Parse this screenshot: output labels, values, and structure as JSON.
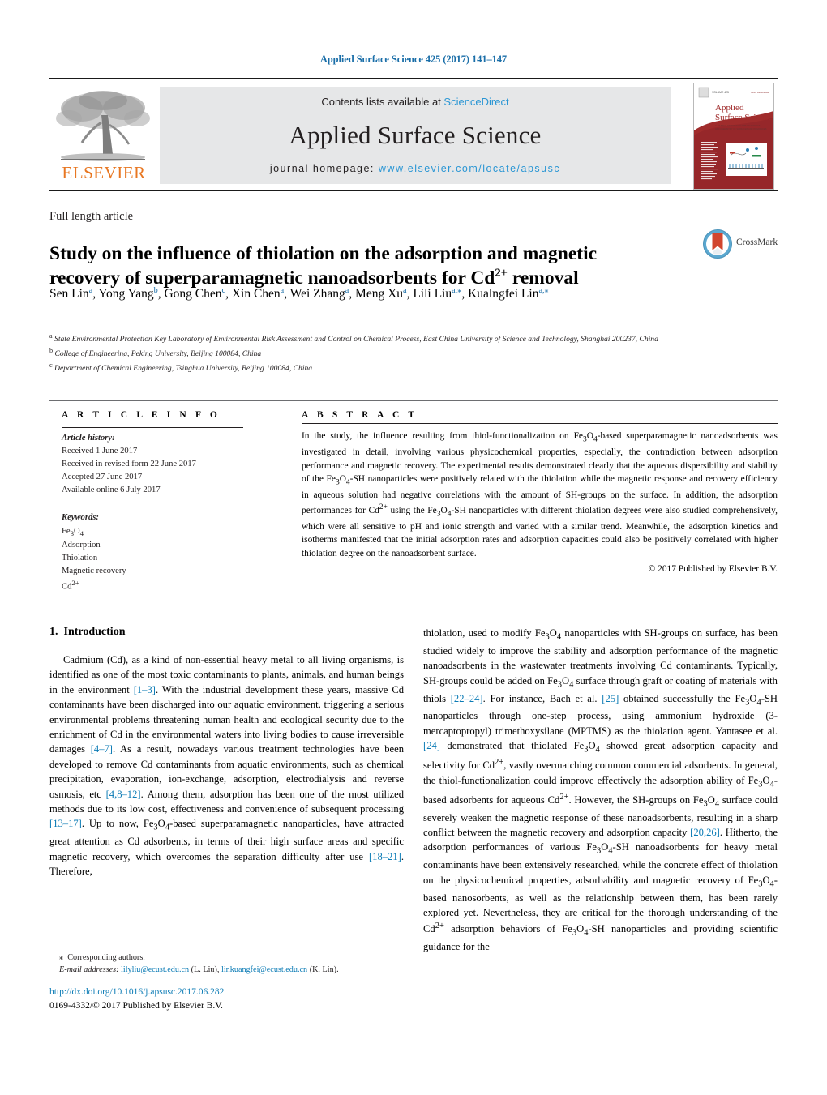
{
  "running_head": "Applied Surface Science 425 (2017) 141–147",
  "masthead": {
    "elsevier_wordmark": "ELSEVIER",
    "contents_prefix": "Contents lists available at ",
    "contents_link": "ScienceDirect",
    "journal_title": "Applied Surface Science",
    "homepage_prefix": "journal homepage: ",
    "homepage_url": "www.elsevier.com/locate/apsusc",
    "cover": {
      "publisher_line": "ELSEVIER",
      "issue_line": "VOLUME 425",
      "title_line1": "Applied",
      "title_line2": "Surface Science",
      "subtitle": "A JOURNAL DEVOTED TO APPLIED PHYSICS AND CHEMISTRY OF SURFACES AND INTERFACES"
    }
  },
  "article_type": "Full length article",
  "title_line1": "Study on the influence of thiolation on the adsorption and magnetic",
  "title_line2_a": "recovery of superparamagnetic nanoadsorbents for Cd",
  "title_line2_sup": "2+",
  "title_line2_b": " removal",
  "crossmark_label": "CrossMark",
  "authors": [
    {
      "name": "Sen Lin",
      "sup": "a",
      "sep": ", "
    },
    {
      "name": "Yong Yang",
      "sup": "b",
      "sep": ", "
    },
    {
      "name": "Gong Chen",
      "sup": "c",
      "sep": ", "
    },
    {
      "name": "Xin Chen",
      "sup": "a",
      "sep": ", "
    },
    {
      "name": "Wei Zhang",
      "sup": "a",
      "sep": ", "
    },
    {
      "name": "Meng Xu",
      "sup": "a",
      "sep": ", "
    },
    {
      "name": "Lili Liu",
      "sup": "a,⁎",
      "sep": ", "
    },
    {
      "name": "Kualngfei Lin",
      "sup": "a,⁎",
      "sep": ""
    }
  ],
  "affiliations": [
    {
      "sup": "a",
      "text": "State Environmental Protection Key Laboratory of Environmental Risk Assessment and Control on Chemical Process, East China University of Science and Technology,  Shanghai 200237, China"
    },
    {
      "sup": "b",
      "text": "College of Engineering, Peking University, Beijing 100084, China"
    },
    {
      "sup": "c",
      "text": "Department of Chemical Engineering, Tsinghua University, Beijing 100084, China"
    }
  ],
  "article_info": {
    "heading": "A R T I C L E    I N F O",
    "history_label": "Article history:",
    "history": [
      "Received 1 June 2017",
      "Received in revised form 22 June 2017",
      "Accepted 27 June 2017",
      "Available online 6 July 2017"
    ],
    "keywords_label": "Keywords:",
    "keywords": [
      "Fe3O4",
      "Adsorption",
      "Thiolation",
      "Magnetic recovery",
      "Cd2+"
    ]
  },
  "abstract": {
    "heading": "A B S T R A C T",
    "text": "In the study, the influence resulting from thiol-functionalization on Fe₃O₄-based superparamagnetic nanoadsorbents was investigated in detail, involving various physicochemical properties, especially, the contradiction between adsorption performance and magnetic recovery. The experimental results demonstrated clearly that the aqueous dispersibility and stability of the Fe₃O₄-SH nanoparticles were positively related with the thiolation while the magnetic response and recovery efficiency in aqueous solution had negative correlations with the amount of SH-groups on the surface. In addition, the adsorption performances for Cd²⁺ using the Fe₃O₄-SH nanoparticles with different thiolation degrees were also studied comprehensively, which were all sensitive to pH and ionic strength and varied with a similar trend. Meanwhile, the adsorption kinetics and isotherms manifested that the initial adsorption rates and adsorption capacities could also be positively correlated with higher thiolation degree on the nanoadsorbent surface.",
    "copyright": "© 2017 Published by Elsevier B.V."
  },
  "body": {
    "section_number": "1.",
    "section_title": "Introduction",
    "left_paragraph": "Cadmium (Cd), as a kind of non-essential heavy metal to all living organisms, is identified as one of the most toxic contaminants to plants, animals, and human beings in the environment [1–3]. With the industrial development these years, massive Cd contaminants have been discharged into our aquatic environment, triggering a serious environmental problems threatening human health and ecological security due to the enrichment of Cd in the environmental waters into living bodies to cause irreversible damages [4–7]. As a result, nowadays various treatment technologies have been developed to remove Cd contaminants from aquatic environments, such as chemical precipitation, evaporation, ion-exchange, adsorption, electrodialysis and reverse osmosis, etc [4,8–12]. Among them, adsorption has been one of the most utilized methods due to its low cost, effectiveness and convenience of subsequent processing [13–17]. Up to now, Fe₃O₄-based superparamagnetic nanoparticles, have attracted great attention as Cd adsorbents, in terms of their high surface areas and specific magnetic recovery, which overcomes the separation difficulty after use [18–21]. Therefore,",
    "right_paragraph": "thiolation, used to modify Fe₃O₄ nanoparticles with SH-groups on surface, has been studied widely to improve the stability and adsorption performance of the magnetic nanoadsorbents in the wastewater treatments involving Cd contaminants. Typically, SH-groups could be added on Fe₃O₄ surface through graft or coating of materials with thiols [22–24]. For instance, Bach et al. [25] obtained successfully the Fe₃O₄-SH nanoparticles through one-step process, using ammonium hydroxide (3-mercaptopropyl) trimethoxysilane (MPTMS) as the thiolation agent. Yantasee et al. [24] demonstrated that thiolated Fe₃O₄ showed great adsorption capacity and selectivity for Cd²⁺, vastly overmatching common commercial adsorbents. In general, the thiol-functionalization could improve effectively the adsorption ability of Fe₃O₄-based adsorbents for aqueous Cd²⁺. However, the SH-groups on Fe₃O₄ surface could severely weaken the magnetic response of these nanoadsorbents, resulting in a sharp conflict between the magnetic recovery and adsorption capacity [20,26]. Hitherto, the adsorption performances of various Fe₃O₄-SH nanoadsorbents for heavy metal contaminants have been extensively researched, while the concrete effect of thiolation on the physicochemical properties, adsorbability and magnetic recovery of Fe₃O₄-based nanosorbents, as well as the relationship between them, has been rarely explored yet. Nevertheless, they are critical for the thorough understanding of the Cd²⁺ adsorption behaviors of Fe₃O₄-SH nanoparticles and providing scientific guidance for the"
  },
  "footnote": {
    "star": "⁎",
    "corresponding": "Corresponding authors.",
    "email_label": "E-mail addresses:",
    "email1": "lilyliu@ecust.edu.cn",
    "email1_owner": "(L. Liu),",
    "email2": "linkuangfei@ecust.edu.cn",
    "email2_owner": "(K. Lin)."
  },
  "doi": "http://dx.doi.org/10.1016/j.apsusc.2017.06.282",
  "issn_line": "0169-4332/© 2017 Published by Elsevier B.V.",
  "colors": {
    "link": "#0b7bb5",
    "sciencedirect": "#2a96d4",
    "elsevier_orange": "#e87722",
    "band_gray": "#e6e7e8",
    "cover_red": "#a02c2c",
    "crossmark_blue": "#5ba8d0",
    "crossmark_red": "#d1462f"
  }
}
